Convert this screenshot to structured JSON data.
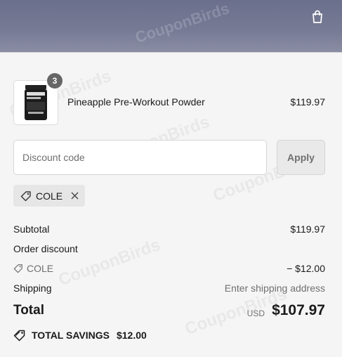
{
  "header": {
    "watermark": "CouponBirds",
    "cart_icon": "shopping-bag-icon"
  },
  "product": {
    "name": "Pineapple Pre-Workout Powder",
    "quantity": "3",
    "price": "$119.97"
  },
  "discount": {
    "placeholder": "Discount code",
    "apply_label": "Apply"
  },
  "applied_code": {
    "code": "COLE",
    "icon": "tag-icon",
    "remove_icon": "close-icon"
  },
  "summary": {
    "subtotal_label": "Subtotal",
    "subtotal_value": "$119.97",
    "order_discount_label": "Order discount",
    "discount_code": "COLE",
    "discount_value": "− $12.00",
    "shipping_label": "Shipping",
    "shipping_value": "Enter shipping address",
    "total_label": "Total",
    "currency": "USD",
    "total_value": "$107.97"
  },
  "savings": {
    "label": "TOTAL SAVINGS",
    "amount": "$12.00"
  },
  "watermark": "CouponBirds"
}
